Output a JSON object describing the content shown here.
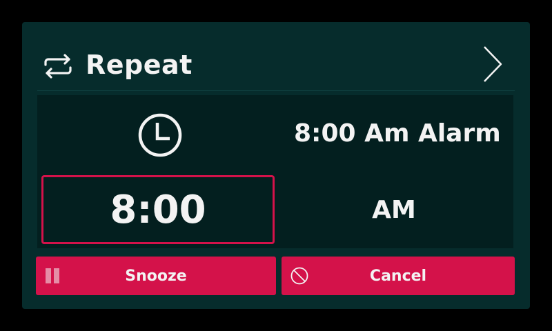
{
  "header": {
    "title": "Repeat",
    "icon": "repeat-icon",
    "next_icon": "chevron-right-icon"
  },
  "alarm": {
    "name": "8:00 Am Alarm",
    "icon": "clock-icon",
    "time": "8:00",
    "period": "AM"
  },
  "actions": {
    "snooze_label": "Snooze",
    "snooze_icon": "pause-icon",
    "cancel_label": "Cancel",
    "cancel_icon": "cancel-icon"
  },
  "colors": {
    "background": "#000000",
    "panel": "#062c2c",
    "card": "#031f1f",
    "accent": "#d4124a",
    "text": "#f3f3f3"
  }
}
